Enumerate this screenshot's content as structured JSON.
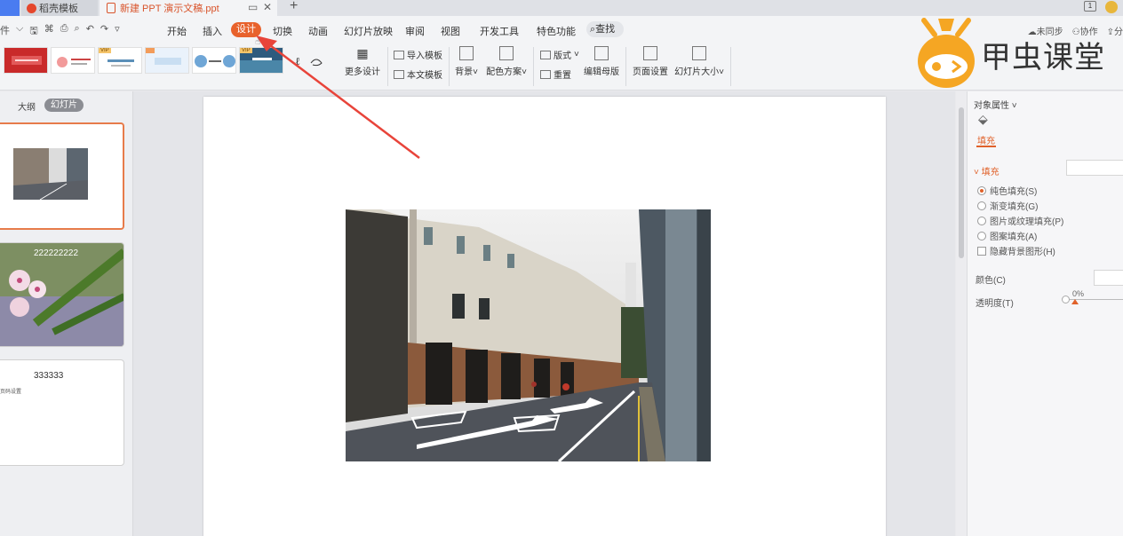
{
  "tabs": {
    "tab1": "稻壳模板",
    "tab2": "新建 PPT 演示文稿.ppt"
  },
  "menu": {
    "file_partial": "件",
    "items": [
      "开始",
      "插入",
      "设计",
      "切换",
      "动画",
      "幻灯片放映",
      "审阅",
      "视图",
      "开发工具",
      "特色功能"
    ],
    "active": "设计",
    "search": "查找",
    "sync": "未同步",
    "collab": "协作",
    "share_partial": "分"
  },
  "ribbon": {
    "vip_badge": "VIP",
    "more_design": "更多设计",
    "import_template": "导入模板",
    "text_template": "本文模板",
    "background": "背景",
    "color_scheme": "配色方案",
    "layout": "版式",
    "reset": "重置",
    "edit_master": "编辑母版",
    "page_setup": "页面设置",
    "slide_size": "幻灯片大小"
  },
  "left_panel": {
    "outline_tab": "大纲",
    "slides_tab": "幻灯片",
    "slide2_text": "222222222",
    "slide3_title": "333333",
    "slide3_sub": "页码设置"
  },
  "right_pane": {
    "title": "对象属性",
    "fill_tab": "填充",
    "fill_section": "填充",
    "options": [
      "纯色填充(S)",
      "渐变填充(G)",
      "图片或纹理填充(P)",
      "图案填充(A)"
    ],
    "hide_bg": "隐藏背景图形(H)",
    "color_label": "颜色(C)",
    "transparency_label": "透明度(T)",
    "transparency_value": "0%"
  },
  "watermark": {
    "text": "甲虫课堂"
  },
  "colors": {
    "accent": "#e8622c",
    "annotation_arrow": "#e8443a"
  }
}
